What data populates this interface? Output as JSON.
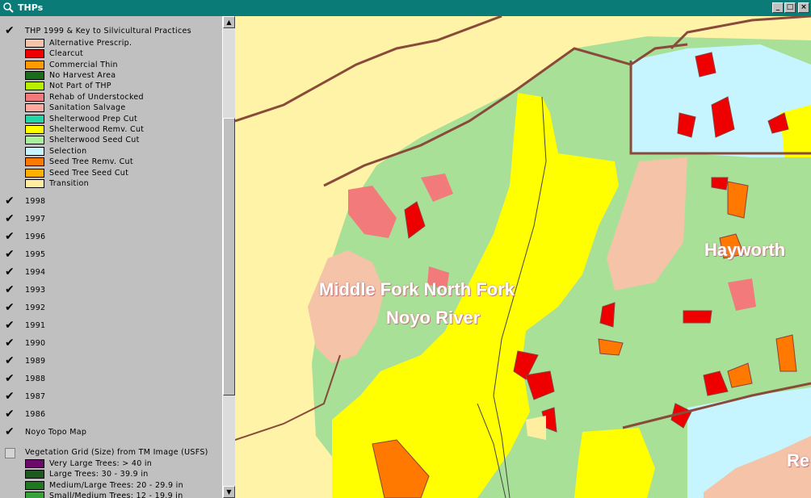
{
  "window": {
    "title": "THPs",
    "min": "_",
    "max": "□",
    "close": "×"
  },
  "legend": {
    "main_layer": "THP 1999 & Key to Silvicultural Practices",
    "practices": [
      {
        "label": "Alternative Prescrip.",
        "color": "#f4c3a8"
      },
      {
        "label": "Clearcut",
        "color": "#ee0000"
      },
      {
        "label": "Commercial Thin",
        "color": "#ff9a00"
      },
      {
        "label": "No Harvest Area",
        "color": "#1a6e1a"
      },
      {
        "label": "Not Part of THP",
        "color": "#b8f000"
      },
      {
        "label": "Rehab of Understocked",
        "color": "#f27a7a"
      },
      {
        "label": "Sanitation Salvage",
        "color": "#ffaaa0"
      },
      {
        "label": "Shelterwood Prep Cut",
        "color": "#22d6a8"
      },
      {
        "label": "Shelterwood Remv. Cut",
        "color": "#ffff00"
      },
      {
        "label": "Shelterwood Seed Cut",
        "color": "#a8f09a"
      },
      {
        "label": "Selection",
        "color": "#c6f4ff"
      },
      {
        "label": "Seed Tree Remv. Cut",
        "color": "#ff7800"
      },
      {
        "label": "Seed Tree Seed Cut",
        "color": "#ffb000"
      },
      {
        "label": "Transition",
        "color": "#ffeea0"
      }
    ],
    "years": [
      "1998",
      "1997",
      "1996",
      "1995",
      "1994",
      "1993",
      "1992",
      "1991",
      "1990",
      "1989",
      "1988",
      "1987",
      "1986"
    ],
    "topo_layer": "Noyo Topo Map",
    "veg_layer": "Vegetation Grid (Size) from TM Image (USFS)",
    "veg_classes": [
      {
        "label": "Very Large Trees: > 40  in",
        "color": "#6b0a6b"
      },
      {
        "label": "Large Trees: 30 - 39.9 in",
        "color": "#1d5a1d"
      },
      {
        "label": "Medium/Large Trees: 20 - 29.9 in",
        "color": "#1f7a1f"
      },
      {
        "label": "Small/Medium Trees: 12 - 19.9 in",
        "color": "#3aa03a"
      }
    ]
  },
  "map": {
    "labels": [
      "Middle Fork North Fork",
      "Noyo River",
      "Hayworth",
      "Re"
    ]
  }
}
